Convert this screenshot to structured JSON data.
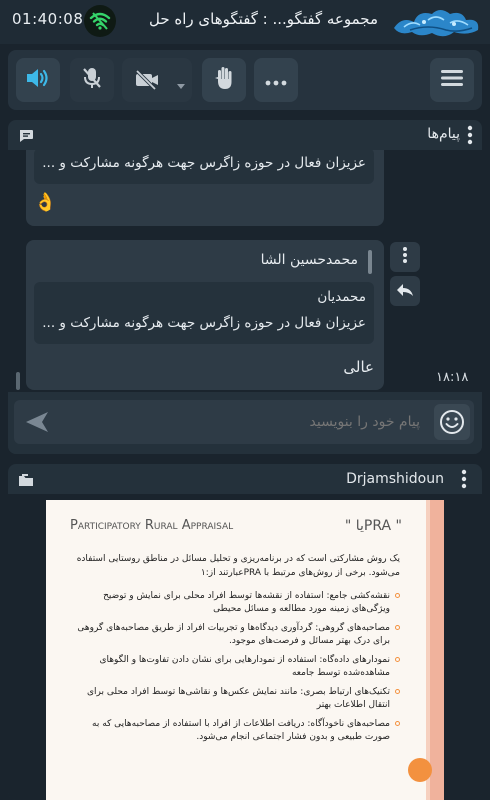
{
  "header": {
    "clock": "01:40:08",
    "title": "مجموعه گفتگو... : گفتگوهای راه حل"
  },
  "toolbar": {
    "buttons": [
      "menu",
      "more",
      "raise-hand",
      "camera-off",
      "mic-off",
      "speaker-on"
    ]
  },
  "chat": {
    "title": "پیام‌ها",
    "messages": [
      {
        "quote_text": "عزیزان فعال در حوزه زاگرس جهت هرگونه مشارکت و ...",
        "body": "👌"
      },
      {
        "sender": "محمدحسین الشا",
        "quote_author": "محمدیان",
        "quote_text": "عزیزان فعال در حوزه زاگرس جهت هرگونه مشارکت و ...",
        "body": "عالی",
        "time": "۱۸:۱۸"
      }
    ],
    "input_placeholder": "پیام خود را بنویسید"
  },
  "document": {
    "owner": "Drjamshidoun",
    "slide": {
      "title_en": "Participatory Rural Appraisal",
      "title_prefix": "\" PRAیا \"",
      "intro": "یک روش مشارکتی است که در برنامه‌ریزی و تحلیل مسائل در مناطق روستایی استفاده می‌شود. برخی از روش‌های مرتبط با PRAعبارتند از:۱",
      "bullets": [
        "نقشه‌کشی جامع: استفاده از نقشه‌ها توسط افراد محلی برای نمایش و توضیح ویژگی‌های زمینه مورد مطالعه و مسائل محیطی",
        "مصاحبه‌های گروهی: گردآوری دیدگاه‌ها و تجربیات افراد از طریق مصاحبه‌های گروهی برای درک بهتر مسائل و فرصت‌های موجود.",
        "نمودارهای داده‌گاه: استفاده از نمودارهایی برای نشان دادن تفاوت‌ها و الگوهای مشاهده‌شده توسط جامعه",
        "تکنیک‌های ارتباط بصری: مانند نمایش عکس‌ها و نقاشی‌ها توسط افراد محلی برای انتقال اطلاعات بهتر",
        "مصاحبه‌های ناخودآگاه: دریافت اطلاعات از افراد با استفاده از مصاحبه‌هایی که به صورت طبیعی و بدون فشار اجتماعی انجام می‌شود."
      ]
    }
  },
  "colors": {
    "accent": "#3db8e8",
    "signal_green": "#35d46a",
    "orange": "#f3913f"
  }
}
